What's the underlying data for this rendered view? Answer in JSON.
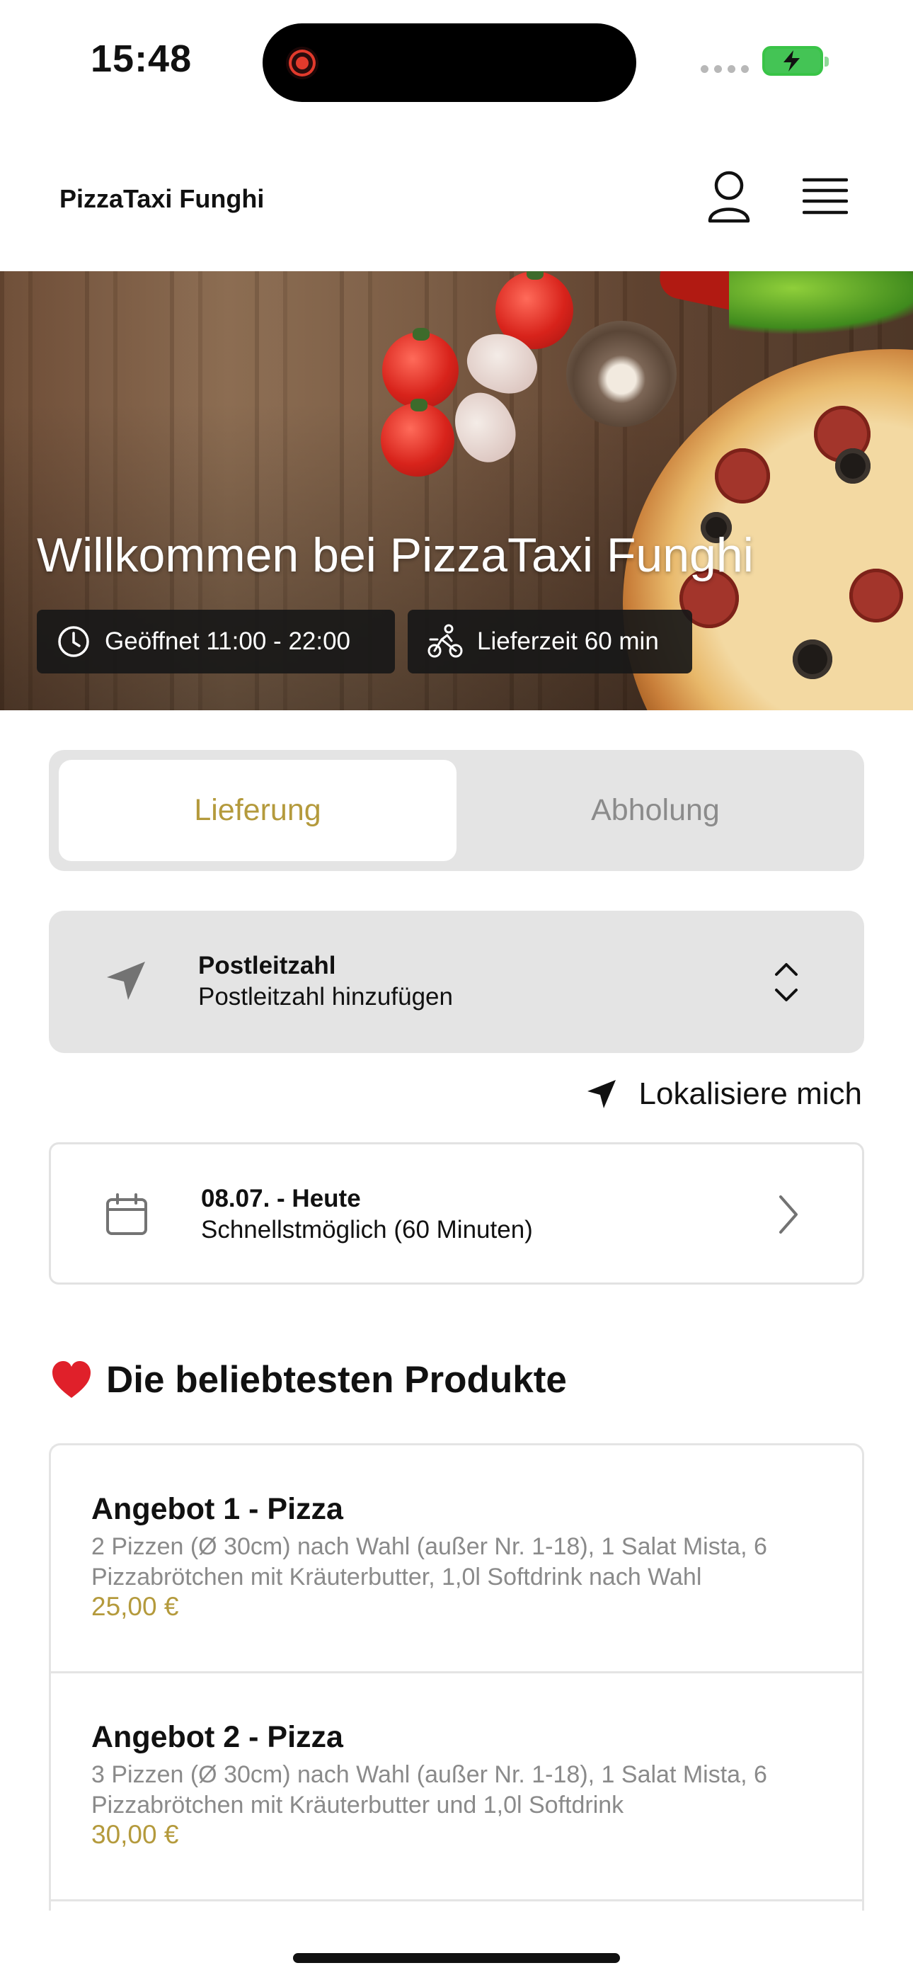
{
  "status_bar": {
    "time": "15:48"
  },
  "header": {
    "brand": "PizzaTaxi Funghi",
    "icons": [
      "user-icon",
      "menu-icon"
    ]
  },
  "hero": {
    "title": "Willkommen bei PizzaTaxi Funghi",
    "opening": "Geöffnet 11:00 - 22:00",
    "delivery_time": "Lieferzeit 60 min"
  },
  "tabs": {
    "delivery": "Lieferung",
    "pickup": "Abholung",
    "active": "delivery"
  },
  "postcode": {
    "label": "Postleitzahl",
    "placeholder": "Postleitzahl hinzufügen"
  },
  "locate": {
    "label": "Lokalisiere mich"
  },
  "date": {
    "title": "08.07. - Heute",
    "subtitle": "Schnellstmöglich (60 Minuten)"
  },
  "popular": {
    "title": "Die beliebtesten Produkte",
    "products": [
      {
        "name": "Angebot 1 - Pizza",
        "description": "2 Pizzen (Ø 30cm) nach Wahl (außer Nr. 1-18), 1 Salat Mista, 6 Pizzabrötchen mit Kräuterbutter, 1,0l Softdrink nach Wahl",
        "price": "25,00 €"
      },
      {
        "name": "Angebot 2 - Pizza",
        "description": "3 Pizzen (Ø 30cm) nach Wahl (außer Nr. 1-18), 1 Salat Mista, 6 Pizzabrötchen mit Kräuterbutter und 1,0l Softdrink",
        "price": "30,00 €"
      }
    ]
  },
  "colors": {
    "accent": "#b49a3c",
    "tab_bg": "#e4e4e4",
    "chip_bg": "#181818"
  }
}
